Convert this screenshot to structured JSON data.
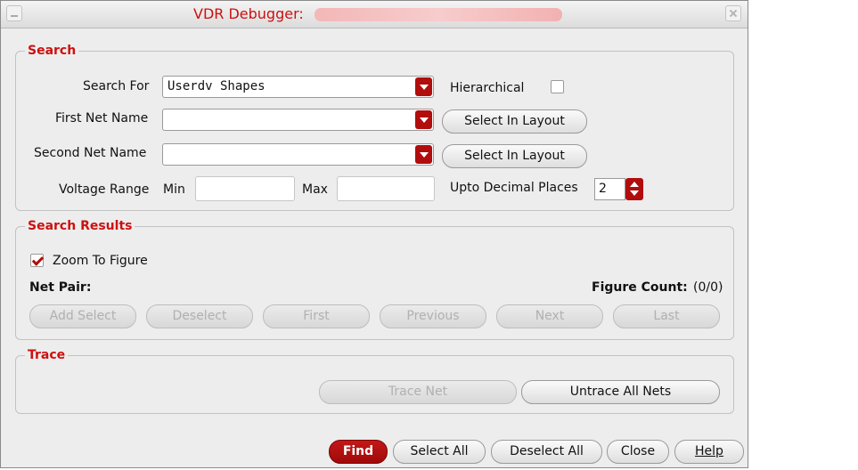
{
  "window": {
    "title": "VDR Debugger:",
    "colors": {
      "accent": "#cc1111",
      "arrow": "#b10d0d",
      "background": "#ededed"
    }
  },
  "search": {
    "legend": "Search",
    "search_for_label": "Search For",
    "search_for_value": "Userdv Shapes",
    "hierarchical_label": "Hierarchical",
    "hierarchical_checked": false,
    "first_net_label": "First Net Name",
    "first_net_value": "",
    "second_net_label": "Second Net Name",
    "second_net_value": "",
    "select_in_layout_label": "Select In Layout",
    "voltage_range_label": "Voltage Range",
    "min_label": "Min",
    "min_value": "",
    "max_label": "Max",
    "max_value": "",
    "decimal_label": "Upto Decimal Places",
    "decimal_value": "2"
  },
  "results": {
    "legend": "Search Results",
    "zoom_label": "Zoom To Figure",
    "zoom_checked": true,
    "net_pair_label": "Net Pair:",
    "figure_count_label": "Figure Count:",
    "figure_count_value": "(0/0)",
    "buttons": {
      "add_select": "Add Select",
      "deselect": "Deselect",
      "first": "First",
      "previous": "Previous",
      "next": "Next",
      "last": "Last"
    }
  },
  "trace": {
    "legend": "Trace",
    "trace_net": "Trace Net",
    "untrace_all": "Untrace All Nets"
  },
  "footer": {
    "find": "Find",
    "select_all": "Select All",
    "deselect_all": "Deselect All",
    "close": "Close",
    "help": "Help"
  }
}
